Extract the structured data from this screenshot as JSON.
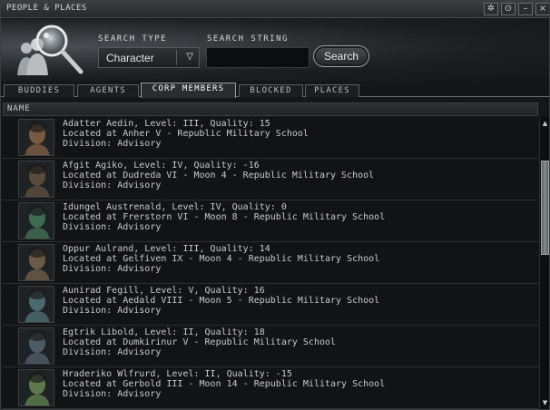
{
  "window": {
    "title": "PEOPLE & PLACES"
  },
  "titlebar_buttons": [
    {
      "name": "settings-icon",
      "glyph": "✲"
    },
    {
      "name": "info-icon",
      "glyph": "⊙"
    },
    {
      "name": "minimize-icon",
      "glyph": "–"
    },
    {
      "name": "close-icon",
      "glyph": "×"
    }
  ],
  "search": {
    "type_label": "SEARCH TYPE",
    "string_label": "SEARCH STRING",
    "type_value": "Character",
    "string_value": "",
    "button_label": "Search"
  },
  "tabs": [
    {
      "label": "BUDDIES",
      "active": false
    },
    {
      "label": "AGENTS",
      "active": false
    },
    {
      "label": "CORP MEMBERS",
      "active": true
    },
    {
      "label": "BLOCKED",
      "active": false
    },
    {
      "label": "PLACES",
      "active": false
    }
  ],
  "columns": [
    "NAME"
  ],
  "members": [
    {
      "line1": "Adatter Aedin, Level: III, Quality: 15",
      "line2": "Located at Anher V - Republic Military School",
      "line3": "Division: Advisory",
      "portrait": "#7a5a3e"
    },
    {
      "line1": "Afgit Agiko, Level: IV, Quality: -16",
      "line2": "Located at Dudreda VI - Moon 4 - Republic Military School",
      "line3": "Division: Advisory",
      "portrait": "#5a4a3c"
    },
    {
      "line1": "Idungel Austrenald, Level: IV, Quality: 0",
      "line2": "Located at Frerstorn VI - Moon 8 - Republic Military School",
      "line3": "Division: Advisory",
      "portrait": "#3f6a52"
    },
    {
      "line1": "Oppur Aulrand, Level: III, Quality: 14",
      "line2": "Located at Gelfiven IX - Moon 4 - Republic Military School",
      "line3": "Division: Advisory",
      "portrait": "#6b5a48"
    },
    {
      "line1": "Aunirad Fegill, Level: V, Quality: 16",
      "line2": "Located at Aedald VIII - Moon 5 - Republic Military School",
      "line3": "Division: Advisory",
      "portrait": "#4a6a6e"
    },
    {
      "line1": "Egtrik Libold, Level: II, Quality: 18",
      "line2": "Located at Dumkirinur V - Republic Military School",
      "line3": "Division: Advisory",
      "portrait": "#4c5a66"
    },
    {
      "line1": "Hraderiko Wlfrurd, Level: II, Quality: -15",
      "line2": "Located at Gerbold III - Moon 14 - Republic Military School",
      "line3": "Division: Advisory",
      "portrait": "#5c7a4c"
    }
  ],
  "colors": {
    "background": "#141617",
    "row": "#121314",
    "text": "#c8cacb",
    "active_tab": "#2a2d30"
  }
}
